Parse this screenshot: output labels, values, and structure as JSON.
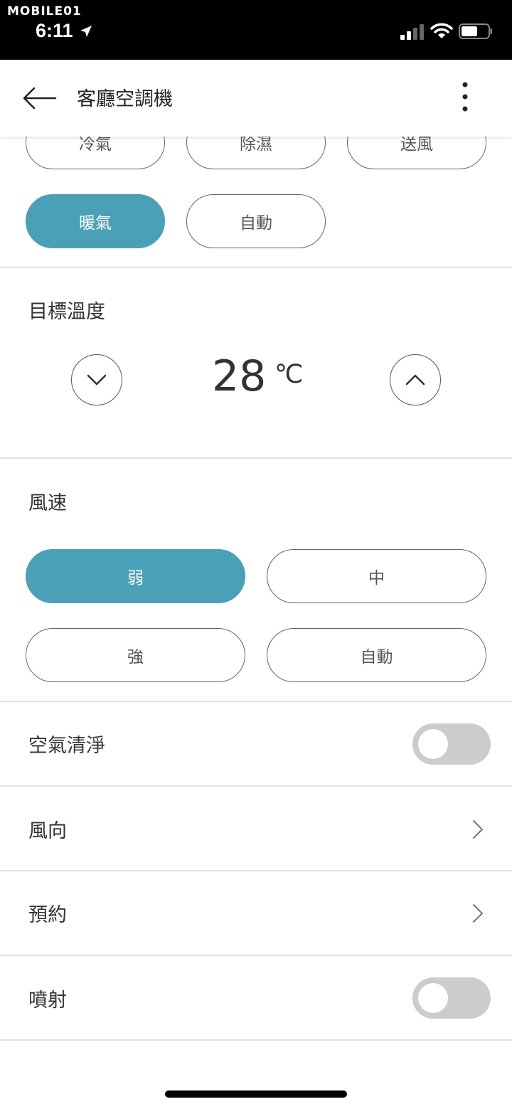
{
  "status_bar": {
    "watermark": "MOBILE01",
    "time": "6:11"
  },
  "header": {
    "title": "客廳空調機"
  },
  "mode": {
    "buttons": [
      {
        "label": "冷氣",
        "active": false
      },
      {
        "label": "除濕",
        "active": false
      },
      {
        "label": "送風",
        "active": false
      },
      {
        "label": "暖氣",
        "active": true
      },
      {
        "label": "自動",
        "active": false
      }
    ]
  },
  "temperature": {
    "label": "目標溫度",
    "value": "28",
    "unit": "℃"
  },
  "fan_speed": {
    "label": "風速",
    "buttons": [
      {
        "label": "弱",
        "active": true
      },
      {
        "label": "中",
        "active": false
      },
      {
        "label": "強",
        "active": false
      },
      {
        "label": "自動",
        "active": false
      }
    ]
  },
  "rows": [
    {
      "label": "空氣清淨",
      "control": "toggle",
      "on": false
    },
    {
      "label": "風向",
      "control": "chevron"
    },
    {
      "label": "預約",
      "control": "chevron"
    },
    {
      "label": "噴射",
      "control": "toggle",
      "on": false
    }
  ],
  "colors": {
    "accent": "#4aa0b6",
    "toggle_off": "#cccccc"
  }
}
